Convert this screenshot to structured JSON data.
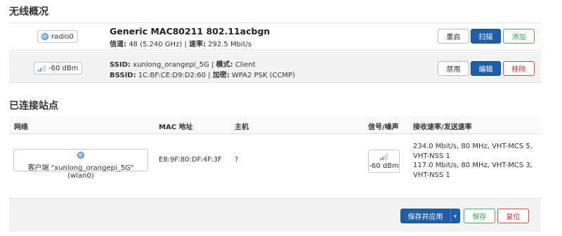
{
  "wireless_overview": {
    "title": "无线概况",
    "radio": {
      "badge": "radio0",
      "name": "Generic MAC80211 802.11acbgn",
      "channel_label": "信道:",
      "channel_value": "48 (5.240 GHz)",
      "rate_label": "速率:",
      "rate_value": "292.5 Mbit/s",
      "buttons": {
        "restart": "重启",
        "scan": "扫描",
        "add": "添加"
      }
    },
    "network": {
      "signal_badge": "-60 dBm",
      "ssid_label": "SSID:",
      "ssid_value": "xunlong_orangepi_5G",
      "mode_label": "模式:",
      "mode_value": "Client",
      "bssid_label": "BSSID:",
      "bssid_value": "1C:BF:CE:D9:D2:60",
      "enc_label": "加密:",
      "enc_value": "WPA2 PSK (CCMP)",
      "buttons": {
        "disable": "禁用",
        "edit": "编辑",
        "remove": "移除"
      }
    }
  },
  "stations": {
    "title": "已连接站点",
    "columns": [
      "网络",
      "MAC 地址",
      "主机",
      "信号/噪声",
      "接收速率/发送速率"
    ],
    "rows": [
      {
        "network": "客户端 \"xunlong_orangepi_5G\" (wlan0)",
        "mac": "E8:9F:80:DF:4F:3F",
        "host": "?",
        "signal": "-60 dBm",
        "rate_lines": [
          "234.0 Mbit/s, 80 MHz, VHT-MCS 5,",
          "VHT-NSS 1",
          "117.0 Mbit/s, 80 MHz, VHT-MCS 3,",
          "VHT-NSS 1"
        ]
      }
    ]
  },
  "footer": {
    "save_apply": "保存并应用",
    "dropdown_arrow": "▾",
    "save": "保存",
    "reset": "复位"
  },
  "colors": {
    "primary": "#1e5fa8",
    "positive": "#3a9a58",
    "negative": "#cc3333"
  }
}
